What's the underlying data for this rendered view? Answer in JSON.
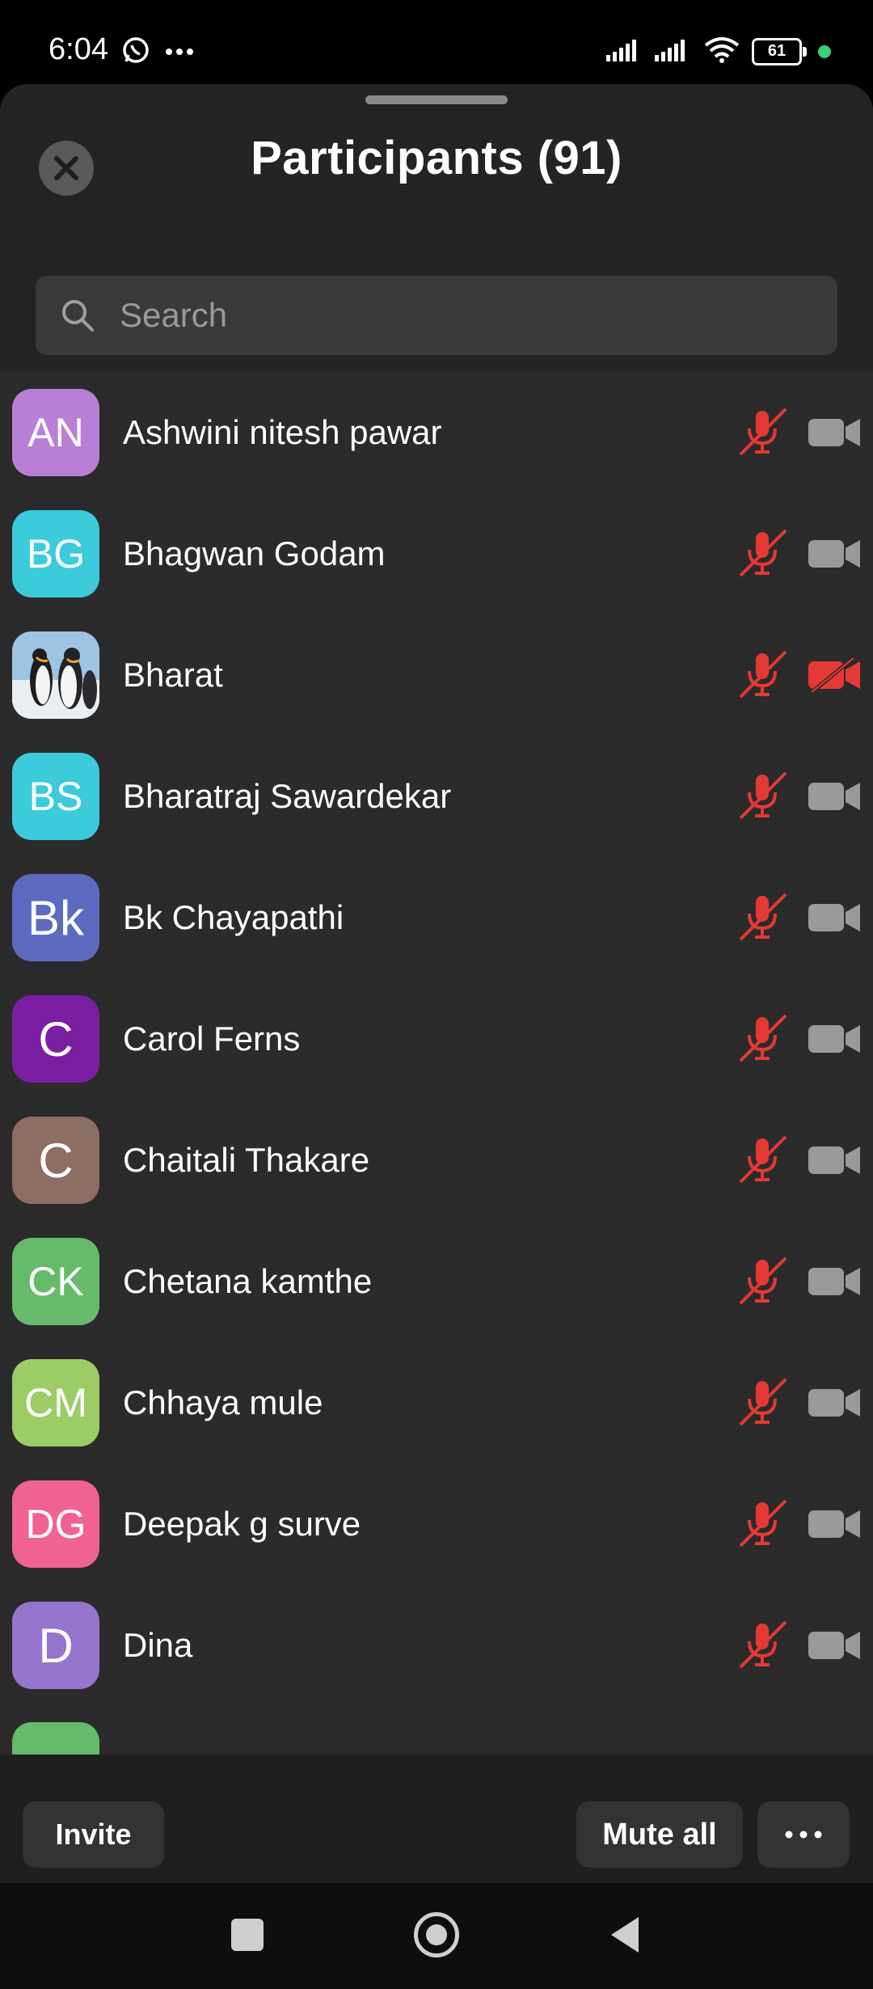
{
  "status_bar": {
    "time": "6:04",
    "battery": "61",
    "icons": [
      "whatsapp-icon",
      "more-dots-icon",
      "signal-icon",
      "signal-icon",
      "wifi-icon",
      "battery-icon"
    ]
  },
  "header": {
    "title": "Participants (91)",
    "search_placeholder": "Search"
  },
  "participants": [
    {
      "initials": "AN",
      "name": "Ashwini nitesh pawar",
      "color": "#b97fd6",
      "mic": "muted",
      "video": "off"
    },
    {
      "initials": "BG",
      "name": "Bhagwan Godam",
      "color": "#3ccbdb",
      "mic": "muted",
      "video": "off"
    },
    {
      "initials": "",
      "name": "Bharat",
      "color": "#6f8fb3",
      "mic": "muted",
      "video": "stopped",
      "avatar": "penguins-photo"
    },
    {
      "initials": "BS",
      "name": "Bharatraj Sawardekar",
      "color": "#3ccbdb",
      "mic": "muted",
      "video": "off"
    },
    {
      "initials": "Bk",
      "name": "Bk Chayapathi",
      "color": "#5c6bc0",
      "mic": "muted",
      "video": "off"
    },
    {
      "initials": "C",
      "name": "Carol Ferns",
      "color": "#7b1fa2",
      "mic": "muted",
      "video": "off"
    },
    {
      "initials": "C",
      "name": "Chaitali Thakare",
      "color": "#8d6e63",
      "mic": "muted",
      "video": "off"
    },
    {
      "initials": "CK",
      "name": "Chetana kamthe",
      "color": "#66bb6a",
      "mic": "muted",
      "video": "off"
    },
    {
      "initials": "CM",
      "name": "Chhaya mule",
      "color": "#9ccc65",
      "mic": "muted",
      "video": "off"
    },
    {
      "initials": "DG",
      "name": "Deepak g surve",
      "color": "#f06292",
      "mic": "muted",
      "video": "off"
    },
    {
      "initials": "D",
      "name": "Dina",
      "color": "#9575cd",
      "mic": "muted",
      "video": "off"
    }
  ],
  "partial_row_color": "#66bb6a",
  "footer": {
    "invite": "Invite",
    "mute_all": "Mute all",
    "more": "•••"
  },
  "colors": {
    "muted_red": "#e53935",
    "video_grey": "#9a9a9a",
    "sheet_bg": "#2b2b2b"
  }
}
